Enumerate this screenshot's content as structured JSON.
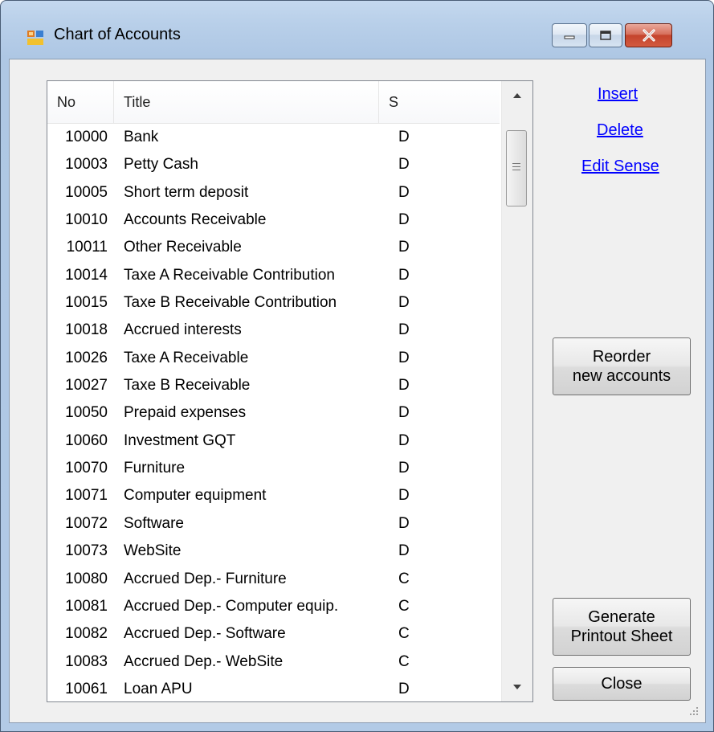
{
  "window": {
    "title": "Chart of Accounts",
    "controls": {
      "minimize": "minimize",
      "maximize": "maximize",
      "close": "close"
    }
  },
  "table": {
    "columns": [
      "No",
      "Title",
      "S"
    ],
    "rows": [
      {
        "no": "10000",
        "title": "Bank",
        "s": "D"
      },
      {
        "no": "10003",
        "title": "Petty Cash",
        "s": "D"
      },
      {
        "no": "10005",
        "title": "Short term deposit",
        "s": "D"
      },
      {
        "no": "10010",
        "title": "Accounts Receivable",
        "s": "D"
      },
      {
        "no": "10011",
        "title": "Other Receivable",
        "s": "D"
      },
      {
        "no": "10014",
        "title": "Taxe A Receivable Contribution",
        "s": "D"
      },
      {
        "no": "10015",
        "title": "Taxe B Receivable Contribution",
        "s": "D"
      },
      {
        "no": "10018",
        "title": "Accrued interests",
        "s": "D"
      },
      {
        "no": "10026",
        "title": "Taxe A Receivable",
        "s": "D"
      },
      {
        "no": "10027",
        "title": "Taxe B Receivable",
        "s": "D"
      },
      {
        "no": "10050",
        "title": "Prepaid expenses",
        "s": "D"
      },
      {
        "no": "10060",
        "title": "Investment GQT",
        "s": "D"
      },
      {
        "no": "10070",
        "title": "Furniture",
        "s": "D"
      },
      {
        "no": "10071",
        "title": "Computer equipment",
        "s": "D"
      },
      {
        "no": "10072",
        "title": "Software",
        "s": "D"
      },
      {
        "no": "10073",
        "title": "WebSite",
        "s": "D"
      },
      {
        "no": "10080",
        "title": "Accrued Dep.- Furniture",
        "s": "C"
      },
      {
        "no": "10081",
        "title": "Accrued Dep.- Computer equip.",
        "s": "C"
      },
      {
        "no": "10082",
        "title": "Accrued Dep.- Software",
        "s": "C"
      },
      {
        "no": "10083",
        "title": "Accrued Dep.- WebSite",
        "s": "C"
      },
      {
        "no": "10061",
        "title": "Loan APU",
        "s": "D"
      }
    ]
  },
  "links": {
    "insert": "Insert",
    "delete": "Delete",
    "edit_sense": "Edit Sense"
  },
  "buttons": {
    "reorder_line1": "Reorder",
    "reorder_line2": "new accounts",
    "generate_line1": "Generate",
    "generate_line2": "Printout Sheet",
    "close": "Close"
  }
}
